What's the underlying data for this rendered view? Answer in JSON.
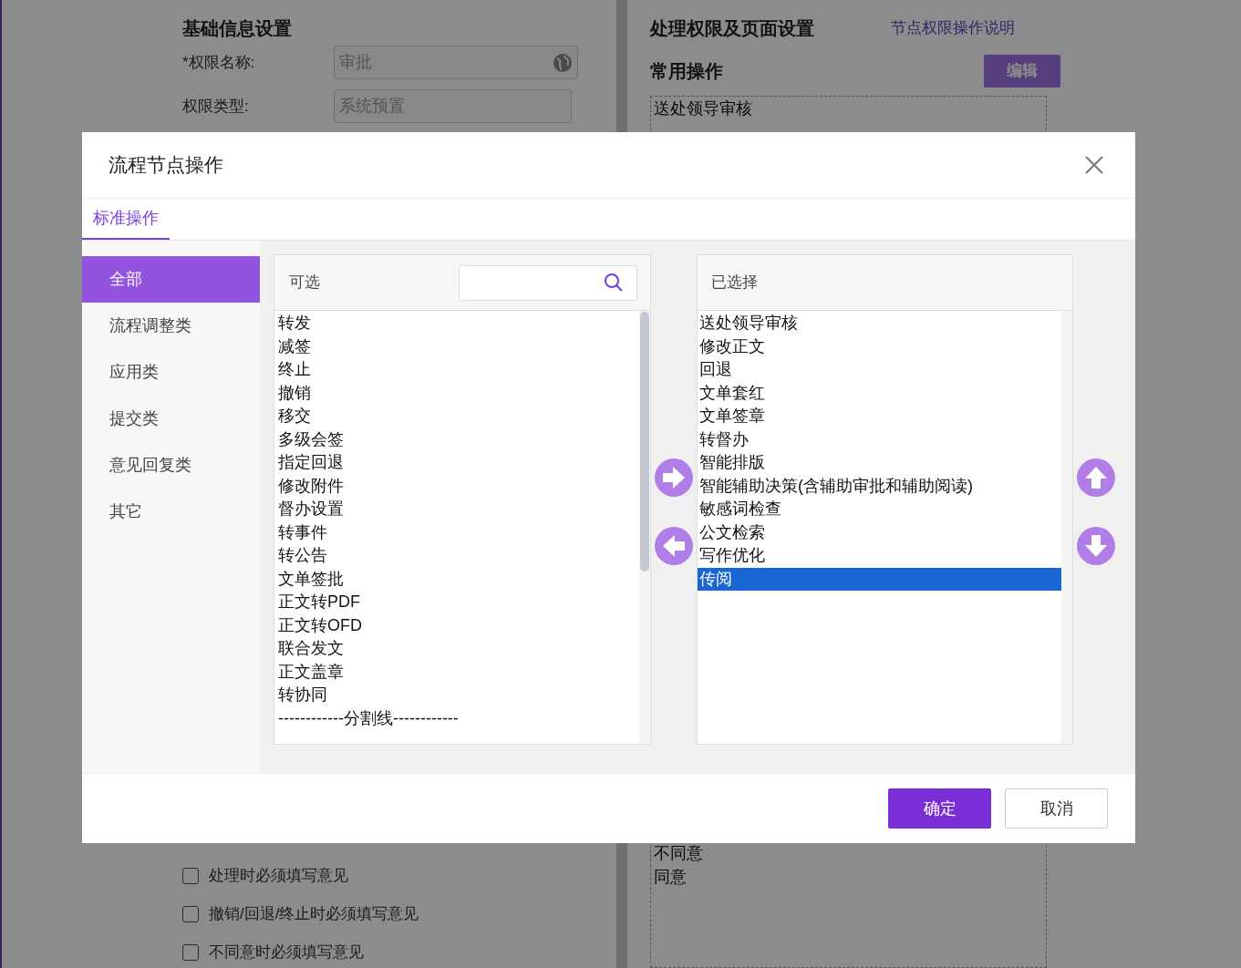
{
  "background": {
    "basic_info": {
      "title": "基础信息设置",
      "fields": [
        {
          "label": "*权限名称:",
          "value": "审批"
        },
        {
          "label": "权限类型:",
          "value": "系统预置"
        }
      ]
    },
    "permissions": {
      "title": "处理权限及页面设置",
      "help_link": "节点权限操作说明",
      "common_ops_title": "常用操作",
      "edit_button": "编辑",
      "common_ops": [
        "送处领导审核"
      ]
    },
    "opinion_settings": {
      "checkboxes": [
        {
          "label": "处理时必须填写意见",
          "checked": false
        },
        {
          "label": "撤销/回退/终止时必须填写意见",
          "checked": false
        },
        {
          "label": "不同意时必须填写意见",
          "checked": false
        }
      ]
    },
    "opinion_phrases": [
      "不同意",
      "同意"
    ]
  },
  "modal": {
    "title": "流程节点操作",
    "tabs": [
      {
        "label": "标准操作",
        "selected": true
      }
    ],
    "categories": [
      {
        "label": "全部",
        "selected": true
      },
      {
        "label": "流程调整类",
        "selected": false
      },
      {
        "label": "应用类",
        "selected": false
      },
      {
        "label": "提交类",
        "selected": false
      },
      {
        "label": "意见回复类",
        "selected": false
      },
      {
        "label": "其它",
        "selected": false
      }
    ],
    "available": {
      "title": "可选",
      "items": [
        "转发",
        "减签",
        "终止",
        "撤销",
        "移交",
        "多级会签",
        "指定回退",
        "修改附件",
        "督办设置",
        "转事件",
        "转公告",
        "文单签批",
        "正文转PDF",
        "正文转OFD",
        "联合发文",
        "正文盖章",
        "转协同",
        "------------分割线------------"
      ]
    },
    "chosen": {
      "title": "已选择",
      "items": [
        {
          "label": "送处领导审核",
          "selected": false
        },
        {
          "label": "修改正文",
          "selected": false
        },
        {
          "label": "回退",
          "selected": false
        },
        {
          "label": "文单套红",
          "selected": false
        },
        {
          "label": "文单签章",
          "selected": false
        },
        {
          "label": "转督办",
          "selected": false
        },
        {
          "label": "智能排版",
          "selected": false
        },
        {
          "label": "智能辅助决策(含辅助审批和辅助阅读)",
          "selected": false
        },
        {
          "label": "敏感词检查",
          "selected": false
        },
        {
          "label": "公文检索",
          "selected": false
        },
        {
          "label": "写作优化",
          "selected": false
        },
        {
          "label": "传阅",
          "selected": true
        }
      ]
    },
    "buttons": [
      {
        "label": "确定",
        "kind": "primary"
      },
      {
        "label": "取消",
        "kind": "default"
      }
    ]
  }
}
